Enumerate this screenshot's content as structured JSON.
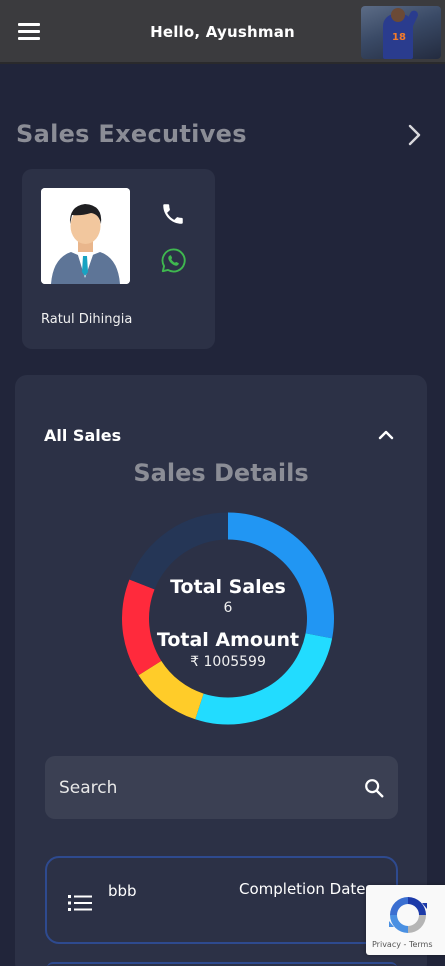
{
  "header": {
    "greeting": "Hello, Ayushman"
  },
  "executives": {
    "title": "Sales Executives",
    "items": [
      {
        "name": "Ratul Dihingia"
      }
    ]
  },
  "sales": {
    "filter_label": "All Sales",
    "details_title": "Sales Details",
    "total_sales_label": "Total Sales",
    "total_sales_value": "6",
    "total_amount_label": "Total Amount",
    "total_amount_value": "₹ 1005599",
    "search": {
      "placeholder": "Search",
      "value": ""
    },
    "rows": [
      {
        "name": "bbb",
        "date_label": "Completion Date"
      }
    ]
  },
  "recaptcha": {
    "links": "Privacy - Terms"
  },
  "chart_data": {
    "type": "pie",
    "style": "donut",
    "segments": [
      {
        "color": "#2196f3",
        "value": 0.28
      },
      {
        "color": "#22dcff",
        "value": 0.27
      },
      {
        "color": "#ffcc29",
        "value": 0.11
      },
      {
        "color": "#ff2a3c",
        "value": 0.15
      },
      {
        "color": "#253656",
        "value": 0.19
      }
    ]
  }
}
